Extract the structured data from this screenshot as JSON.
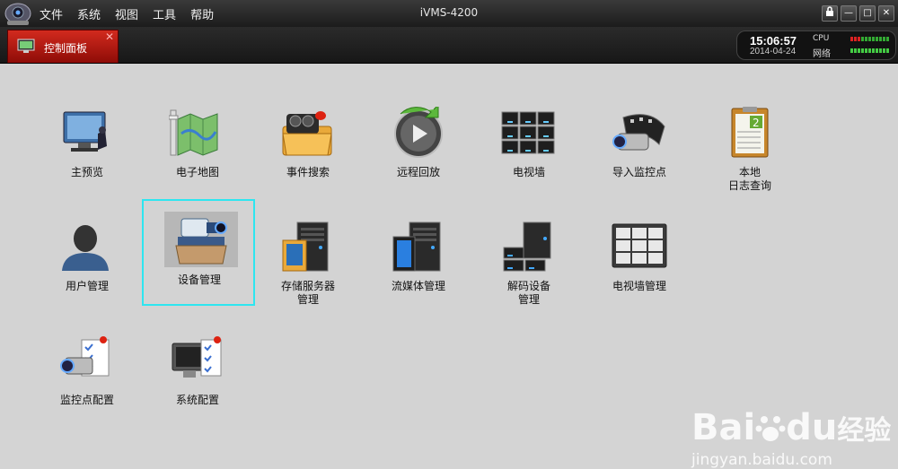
{
  "window": {
    "title": "iVMS-4200"
  },
  "menu": [
    {
      "label": "文件"
    },
    {
      "label": "系统"
    },
    {
      "label": "视图"
    },
    {
      "label": "工具"
    },
    {
      "label": "帮助"
    }
  ],
  "window_buttons": {
    "lock": "🔒",
    "minimize": "—",
    "maximize": "□",
    "close": "✕"
  },
  "tab": {
    "label": "控制面板",
    "close": "✕"
  },
  "status": {
    "time": "15:06:57",
    "date": "2014-04-24",
    "cpu_label": "CPU",
    "net_label": "网络"
  },
  "items": {
    "main_preview": {
      "label": "主预览"
    },
    "emap": {
      "label": "电子地图"
    },
    "event_search": {
      "label": "事件搜索"
    },
    "remote_playback": {
      "label": "远程回放"
    },
    "tv_wall": {
      "label": "电视墙"
    },
    "import_cameras": {
      "label": "导入监控点"
    },
    "local_log": {
      "line1": "本地",
      "line2": "日志查询"
    },
    "user_mgmt": {
      "label": "用户管理"
    },
    "device_mgmt": {
      "label": "设备管理"
    },
    "storage_mgmt": {
      "line1": "存储服务器",
      "line2": "管理"
    },
    "stream_mgmt": {
      "label": "流媒体管理"
    },
    "decoder_mgmt": {
      "line1": "解码设备",
      "line2": "管理"
    },
    "tvwall_mgmt": {
      "label": "电视墙管理"
    },
    "camera_config": {
      "label": "监控点配置"
    },
    "system_config": {
      "label": "系统配置"
    }
  },
  "watermark": {
    "brand": "Bai",
    "brand2": "du",
    "cn": "经验",
    "url": "jingyan.baidu.com"
  },
  "colors": {
    "tab_red": "#c0180f",
    "selection": "#2ee6f0",
    "background": "#d3d3d3"
  }
}
